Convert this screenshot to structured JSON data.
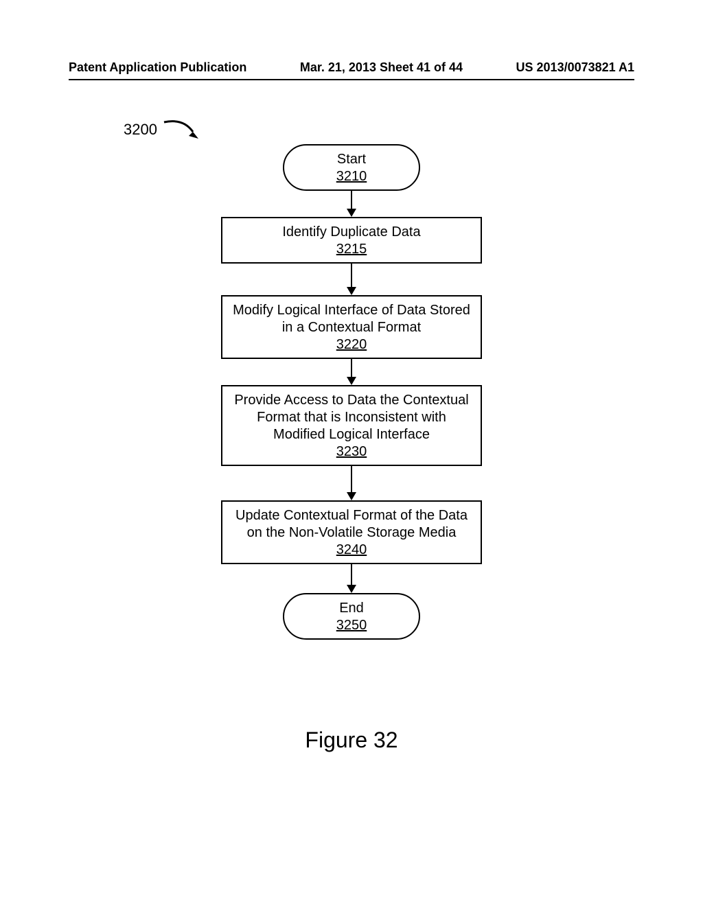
{
  "header": {
    "left": "Patent Application Publication",
    "center": "Mar. 21, 2013  Sheet 41 of 44",
    "right": "US 2013/0073821 A1"
  },
  "flow_ref": "3200",
  "nodes": {
    "start": {
      "label": "Start",
      "ref": "3210"
    },
    "step1": {
      "label": "Identify Duplicate Data",
      "ref": "3215"
    },
    "step2": {
      "label": "Modify Logical Interface of Data Stored in a Contextual Format",
      "ref": "3220"
    },
    "step3": {
      "label": "Provide Access to Data the Contextual Format that is Inconsistent with Modified Logical Interface",
      "ref": "3230"
    },
    "step4": {
      "label": "Update Contextual Format of the Data on the Non-Volatile Storage Media",
      "ref": "3240"
    },
    "end": {
      "label": "End",
      "ref": "3250"
    }
  },
  "caption": "Figure 32"
}
